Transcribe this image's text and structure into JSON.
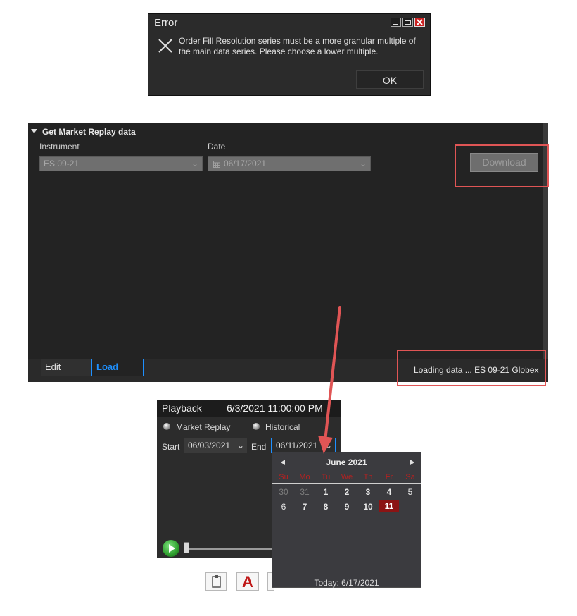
{
  "error_dialog": {
    "title": "Error",
    "message": "Order Fill Resolution series must be a more granular multiple of the main data series. Please choose a lower multiple.",
    "ok_label": "OK"
  },
  "market_replay": {
    "section_title": "Get Market Replay data",
    "instrument_label": "Instrument",
    "instrument_value": "ES 09-21",
    "date_label": "Date",
    "date_value": "06/17/2021",
    "download_label": "Download",
    "tabs": [
      {
        "label": "Edit"
      },
      {
        "label": "Load"
      }
    ],
    "status": "Loading data ... ES 09-21 Globex"
  },
  "playback": {
    "title": "Playback",
    "timestamp": "6/3/2021 11:00:00 PM",
    "mode_market_replay": "Market Replay",
    "mode_historical": "Historical",
    "start_label": "Start",
    "start_value": "06/03/2021",
    "end_label": "End",
    "end_value": "06/11/2021"
  },
  "calendar": {
    "month": "June 2021",
    "weekdays": [
      "Su",
      "Mo",
      "Tu",
      "We",
      "Th",
      "Fr",
      "Sa"
    ],
    "week1": [
      "30",
      "31",
      "1",
      "2",
      "3",
      "4",
      "5"
    ],
    "week2": [
      "6",
      "7",
      "8",
      "9",
      "10",
      "11"
    ],
    "today": "Today: 6/17/2021"
  },
  "colors": {
    "accent": "#1e90ff",
    "highlight_box": "#e05555",
    "selected_day": "#8b1414"
  }
}
